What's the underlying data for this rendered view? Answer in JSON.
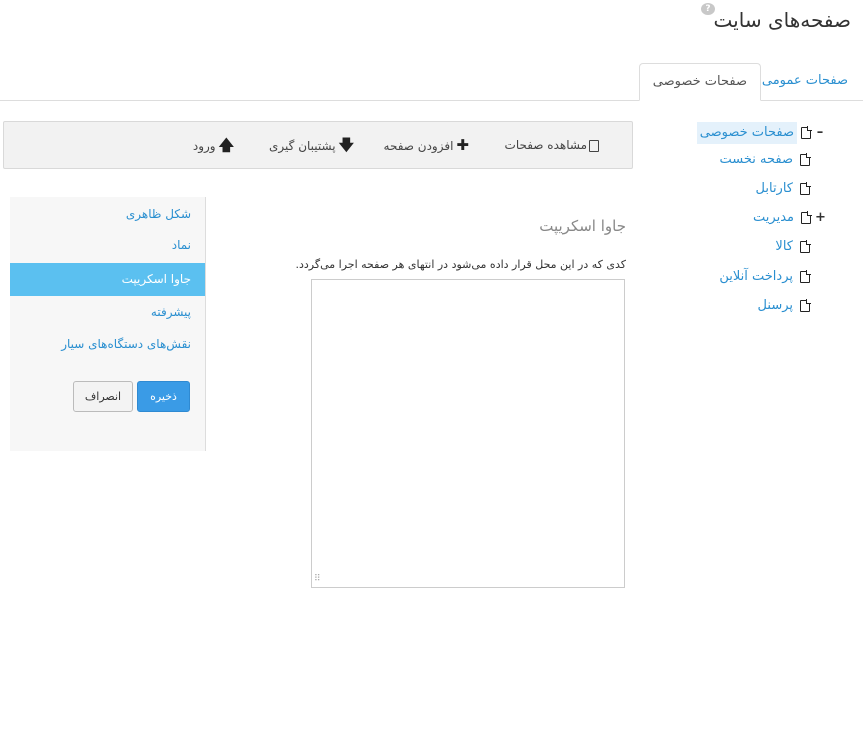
{
  "header": {
    "title": "صفحه‌های سایت",
    "help_icon": "help-icon"
  },
  "tabs": [
    {
      "label": "صفحات عمومی",
      "active": false
    },
    {
      "label": "صفحات خصوصی",
      "active": true
    }
  ],
  "tree": {
    "items": [
      {
        "label": "صفحات خصوصی",
        "toggle": "–",
        "selected": true
      },
      {
        "label": "صفحه نخست"
      },
      {
        "label": "کارتابل"
      },
      {
        "label": "مدیریت",
        "toggle": "+"
      },
      {
        "label": "کالا"
      },
      {
        "label": "پرداخت آنلاین"
      },
      {
        "label": "پرسنل"
      }
    ]
  },
  "toolbar": {
    "view_pages": "مشاهده صفحات",
    "add_page": "افزودن صفحه",
    "backup": "پشتیبان گیری",
    "import": "ورود"
  },
  "side_menu": {
    "items": [
      {
        "label": "شکل ظاهری"
      },
      {
        "label": "نماد"
      },
      {
        "label": "جاوا اسکریپت",
        "active": true
      },
      {
        "label": "پیشرفته"
      },
      {
        "label": "نقش‌های دستگاه‌های سیار"
      }
    ],
    "save_label": "ذخیره",
    "cancel_label": "انصراف"
  },
  "javascript_panel": {
    "heading": "جاوا اسکریپت",
    "description": "کدی که در این محل قرار داده می‌شود در انتهای هر صفحه اجرا می‌گردد.",
    "code_value": ""
  },
  "colors": {
    "link": "#2a8fd0",
    "active_menu": "#5bc0f0",
    "primary_button": "#3a9be6",
    "toolbar_bg": "#f2f2f2"
  }
}
